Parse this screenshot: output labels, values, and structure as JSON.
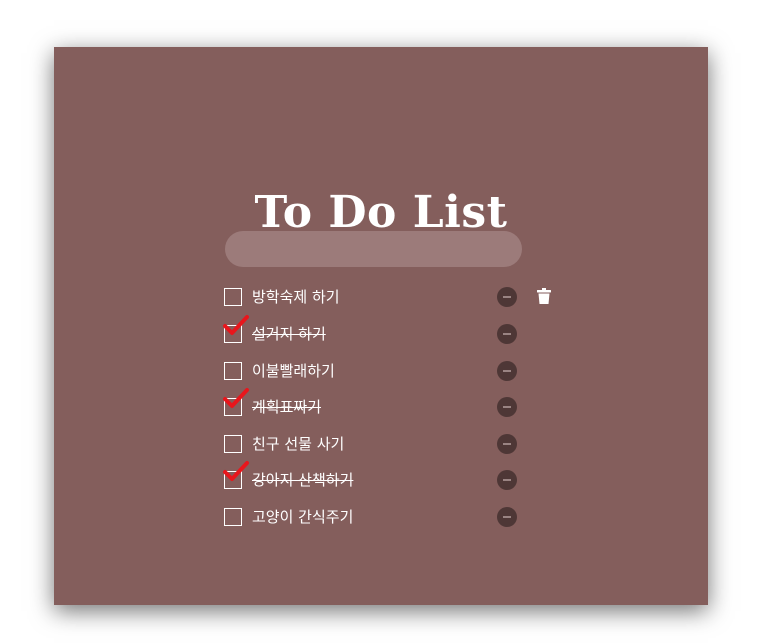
{
  "app": {
    "title": "To Do List"
  },
  "input": {
    "value": "",
    "placeholder": ""
  },
  "todos": [
    {
      "label": "방학숙제 하기",
      "done": false
    },
    {
      "label": "설거지 하기",
      "done": true
    },
    {
      "label": "이불빨래하기",
      "done": false
    },
    {
      "label": "계획표짜기",
      "done": true
    },
    {
      "label": "친구 선물 사기",
      "done": false
    },
    {
      "label": "강아지 산책하기",
      "done": true
    },
    {
      "label": "고양이 간식주기",
      "done": false
    }
  ],
  "icons": {
    "checkmark": "checkmark-icon",
    "delete_item": "minus-circle-icon",
    "trash": "trash-icon"
  },
  "colors": {
    "background": "#845e5c",
    "input_background": "#9c7b7a",
    "check": "#e8161c",
    "delete_button": "#4e3736"
  }
}
